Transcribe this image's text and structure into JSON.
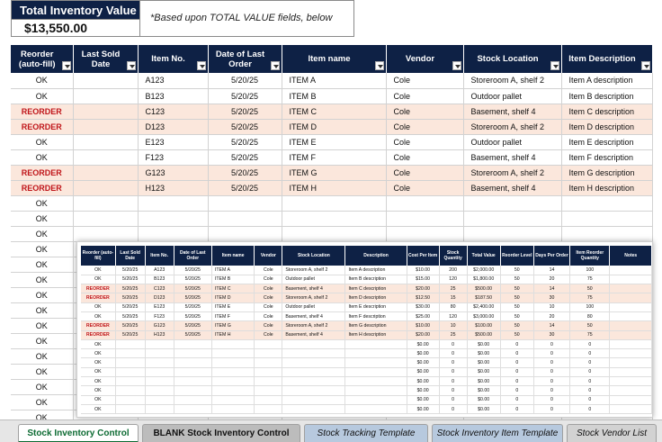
{
  "summary": {
    "title": "Total Inventory Value",
    "value": "$13,550.00",
    "note": "*Based upon TOTAL VALUE fields, below"
  },
  "main_table": {
    "headers": [
      "Reorder (auto-fill)",
      "Last Sold Date",
      "Item No.",
      "Date of Last Order",
      "Item name",
      "Vendor",
      "Stock Location",
      "Item Description"
    ],
    "rows": [
      {
        "reorder": "OK",
        "last_sold": "",
        "item_no": "A123",
        "last_order": "5/20/25",
        "name": "ITEM A",
        "vendor": "Cole",
        "location": "Storeroom A, shelf 2",
        "desc": "Item A description"
      },
      {
        "reorder": "OK",
        "last_sold": "",
        "item_no": "B123",
        "last_order": "5/20/25",
        "name": "ITEM B",
        "vendor": "Cole",
        "location": "Outdoor pallet",
        "desc": "Item B description"
      },
      {
        "reorder": "REORDER",
        "last_sold": "",
        "item_no": "C123",
        "last_order": "5/20/25",
        "name": "ITEM C",
        "vendor": "Cole",
        "location": "Basement, shelf 4",
        "desc": "Item C description"
      },
      {
        "reorder": "REORDER",
        "last_sold": "",
        "item_no": "D123",
        "last_order": "5/20/25",
        "name": "ITEM D",
        "vendor": "Cole",
        "location": "Storeroom A, shelf 2",
        "desc": "Item D description"
      },
      {
        "reorder": "OK",
        "last_sold": "",
        "item_no": "E123",
        "last_order": "5/20/25",
        "name": "ITEM E",
        "vendor": "Cole",
        "location": "Outdoor pallet",
        "desc": "Item E description"
      },
      {
        "reorder": "OK",
        "last_sold": "",
        "item_no": "F123",
        "last_order": "5/20/25",
        "name": "ITEM F",
        "vendor": "Cole",
        "location": "Basement, shelf 4",
        "desc": "Item F description"
      },
      {
        "reorder": "REORDER",
        "last_sold": "",
        "item_no": "G123",
        "last_order": "5/20/25",
        "name": "ITEM G",
        "vendor": "Cole",
        "location": "Storeroom A, shelf 2",
        "desc": "Item G description"
      },
      {
        "reorder": "REORDER",
        "last_sold": "",
        "item_no": "H123",
        "last_order": "5/20/25",
        "name": "ITEM H",
        "vendor": "Cole",
        "location": "Basement, shelf 4",
        "desc": "Item H description"
      },
      {
        "reorder": "OK"
      },
      {
        "reorder": "OK"
      },
      {
        "reorder": "OK"
      },
      {
        "reorder": "OK"
      },
      {
        "reorder": "OK"
      },
      {
        "reorder": "OK"
      },
      {
        "reorder": "OK"
      },
      {
        "reorder": "OK"
      },
      {
        "reorder": "OK"
      },
      {
        "reorder": "OK"
      },
      {
        "reorder": "OK"
      },
      {
        "reorder": "OK"
      },
      {
        "reorder": "OK"
      },
      {
        "reorder": "OK"
      },
      {
        "reorder": "OK"
      }
    ]
  },
  "preview_table": {
    "headers": [
      "Reorder (auto-fill)",
      "Last Sold Date",
      "Item No.",
      "Date of Last Order",
      "Item name",
      "Vendor",
      "Stock Location",
      "Description",
      "Cost Per Item",
      "Stock Quantity",
      "Total Value",
      "Reorder Level",
      "Days Per Order",
      "Item Reorder Quantity",
      "Notes"
    ],
    "rows": [
      [
        "OK",
        "5/20/25",
        "A123",
        "5/20/25",
        "ITEM A",
        "Cole",
        "Storeroom A, shelf 2",
        "Item A description",
        "$10.00",
        "200",
        "$2,000.00",
        "50",
        "14",
        "100",
        ""
      ],
      [
        "OK",
        "5/20/25",
        "B123",
        "5/20/25",
        "ITEM B",
        "Cole",
        "Outdoor pallet",
        "Item B description",
        "$15.00",
        "120",
        "$1,800.00",
        "50",
        "20",
        "75",
        ""
      ],
      [
        "REORDER",
        "5/20/25",
        "C123",
        "5/20/25",
        "ITEM C",
        "Cole",
        "Basement, shelf 4",
        "Item C description",
        "$20.00",
        "25",
        "$500.00",
        "50",
        "14",
        "50",
        ""
      ],
      [
        "REORDER",
        "5/20/25",
        "D123",
        "5/20/25",
        "ITEM D",
        "Cole",
        "Storeroom A, shelf 2",
        "Item D description",
        "$12.50",
        "15",
        "$187.50",
        "50",
        "30",
        "75",
        ""
      ],
      [
        "OK",
        "5/20/25",
        "E123",
        "5/20/25",
        "ITEM E",
        "Cole",
        "Outdoor pallet",
        "Item E description",
        "$30.00",
        "80",
        "$2,400.00",
        "50",
        "10",
        "100",
        ""
      ],
      [
        "OK",
        "5/20/25",
        "F123",
        "5/20/25",
        "ITEM F",
        "Cole",
        "Basement, shelf 4",
        "Item F description",
        "$25.00",
        "120",
        "$3,000.00",
        "50",
        "20",
        "80",
        ""
      ],
      [
        "REORDER",
        "5/20/25",
        "G123",
        "5/20/25",
        "ITEM G",
        "Cole",
        "Storeroom A, shelf 2",
        "Item G description",
        "$10.00",
        "10",
        "$100.00",
        "50",
        "14",
        "50",
        ""
      ],
      [
        "REORDER",
        "5/20/25",
        "H123",
        "5/20/25",
        "ITEM H",
        "Cole",
        "Basement, shelf 4",
        "Item H description",
        "$20.00",
        "25",
        "$500.00",
        "50",
        "30",
        "75",
        ""
      ],
      [
        "OK",
        "",
        "",
        "",
        "",
        "",
        "",
        "",
        "$0.00",
        "0",
        "$0.00",
        "0",
        "0",
        "0",
        ""
      ],
      [
        "OK",
        "",
        "",
        "",
        "",
        "",
        "",
        "",
        "$0.00",
        "0",
        "$0.00",
        "0",
        "0",
        "0",
        ""
      ],
      [
        "OK",
        "",
        "",
        "",
        "",
        "",
        "",
        "",
        "$0.00",
        "0",
        "$0.00",
        "0",
        "0",
        "0",
        ""
      ],
      [
        "OK",
        "",
        "",
        "",
        "",
        "",
        "",
        "",
        "$0.00",
        "0",
        "$0.00",
        "0",
        "0",
        "0",
        ""
      ],
      [
        "OK",
        "",
        "",
        "",
        "",
        "",
        "",
        "",
        "$0.00",
        "0",
        "$0.00",
        "0",
        "0",
        "0",
        ""
      ],
      [
        "OK",
        "",
        "",
        "",
        "",
        "",
        "",
        "",
        "$0.00",
        "0",
        "$0.00",
        "0",
        "0",
        "0",
        ""
      ],
      [
        "OK",
        "",
        "",
        "",
        "",
        "",
        "",
        "",
        "$0.00",
        "0",
        "$0.00",
        "0",
        "0",
        "0",
        ""
      ],
      [
        "OK",
        "",
        "",
        "",
        "",
        "",
        "",
        "",
        "$0.00",
        "0",
        "$0.00",
        "0",
        "0",
        "0",
        ""
      ]
    ]
  },
  "sheet_tabs": [
    {
      "label": "Stock Inventory Control",
      "active": true
    },
    {
      "label": "BLANK Stock Inventory Control",
      "active": false
    },
    {
      "label": "Stock Tracking Template",
      "active": false
    },
    {
      "label": "Stock Inventory Item Template",
      "active": false
    },
    {
      "label": "Stock Vendor List",
      "active": false
    }
  ],
  "colors": {
    "header_bg": "#0e2145",
    "reorder_text": "#c0161a",
    "reorder_row_bg": "#fbe7dc",
    "active_tab_text": "#0d6b33"
  }
}
